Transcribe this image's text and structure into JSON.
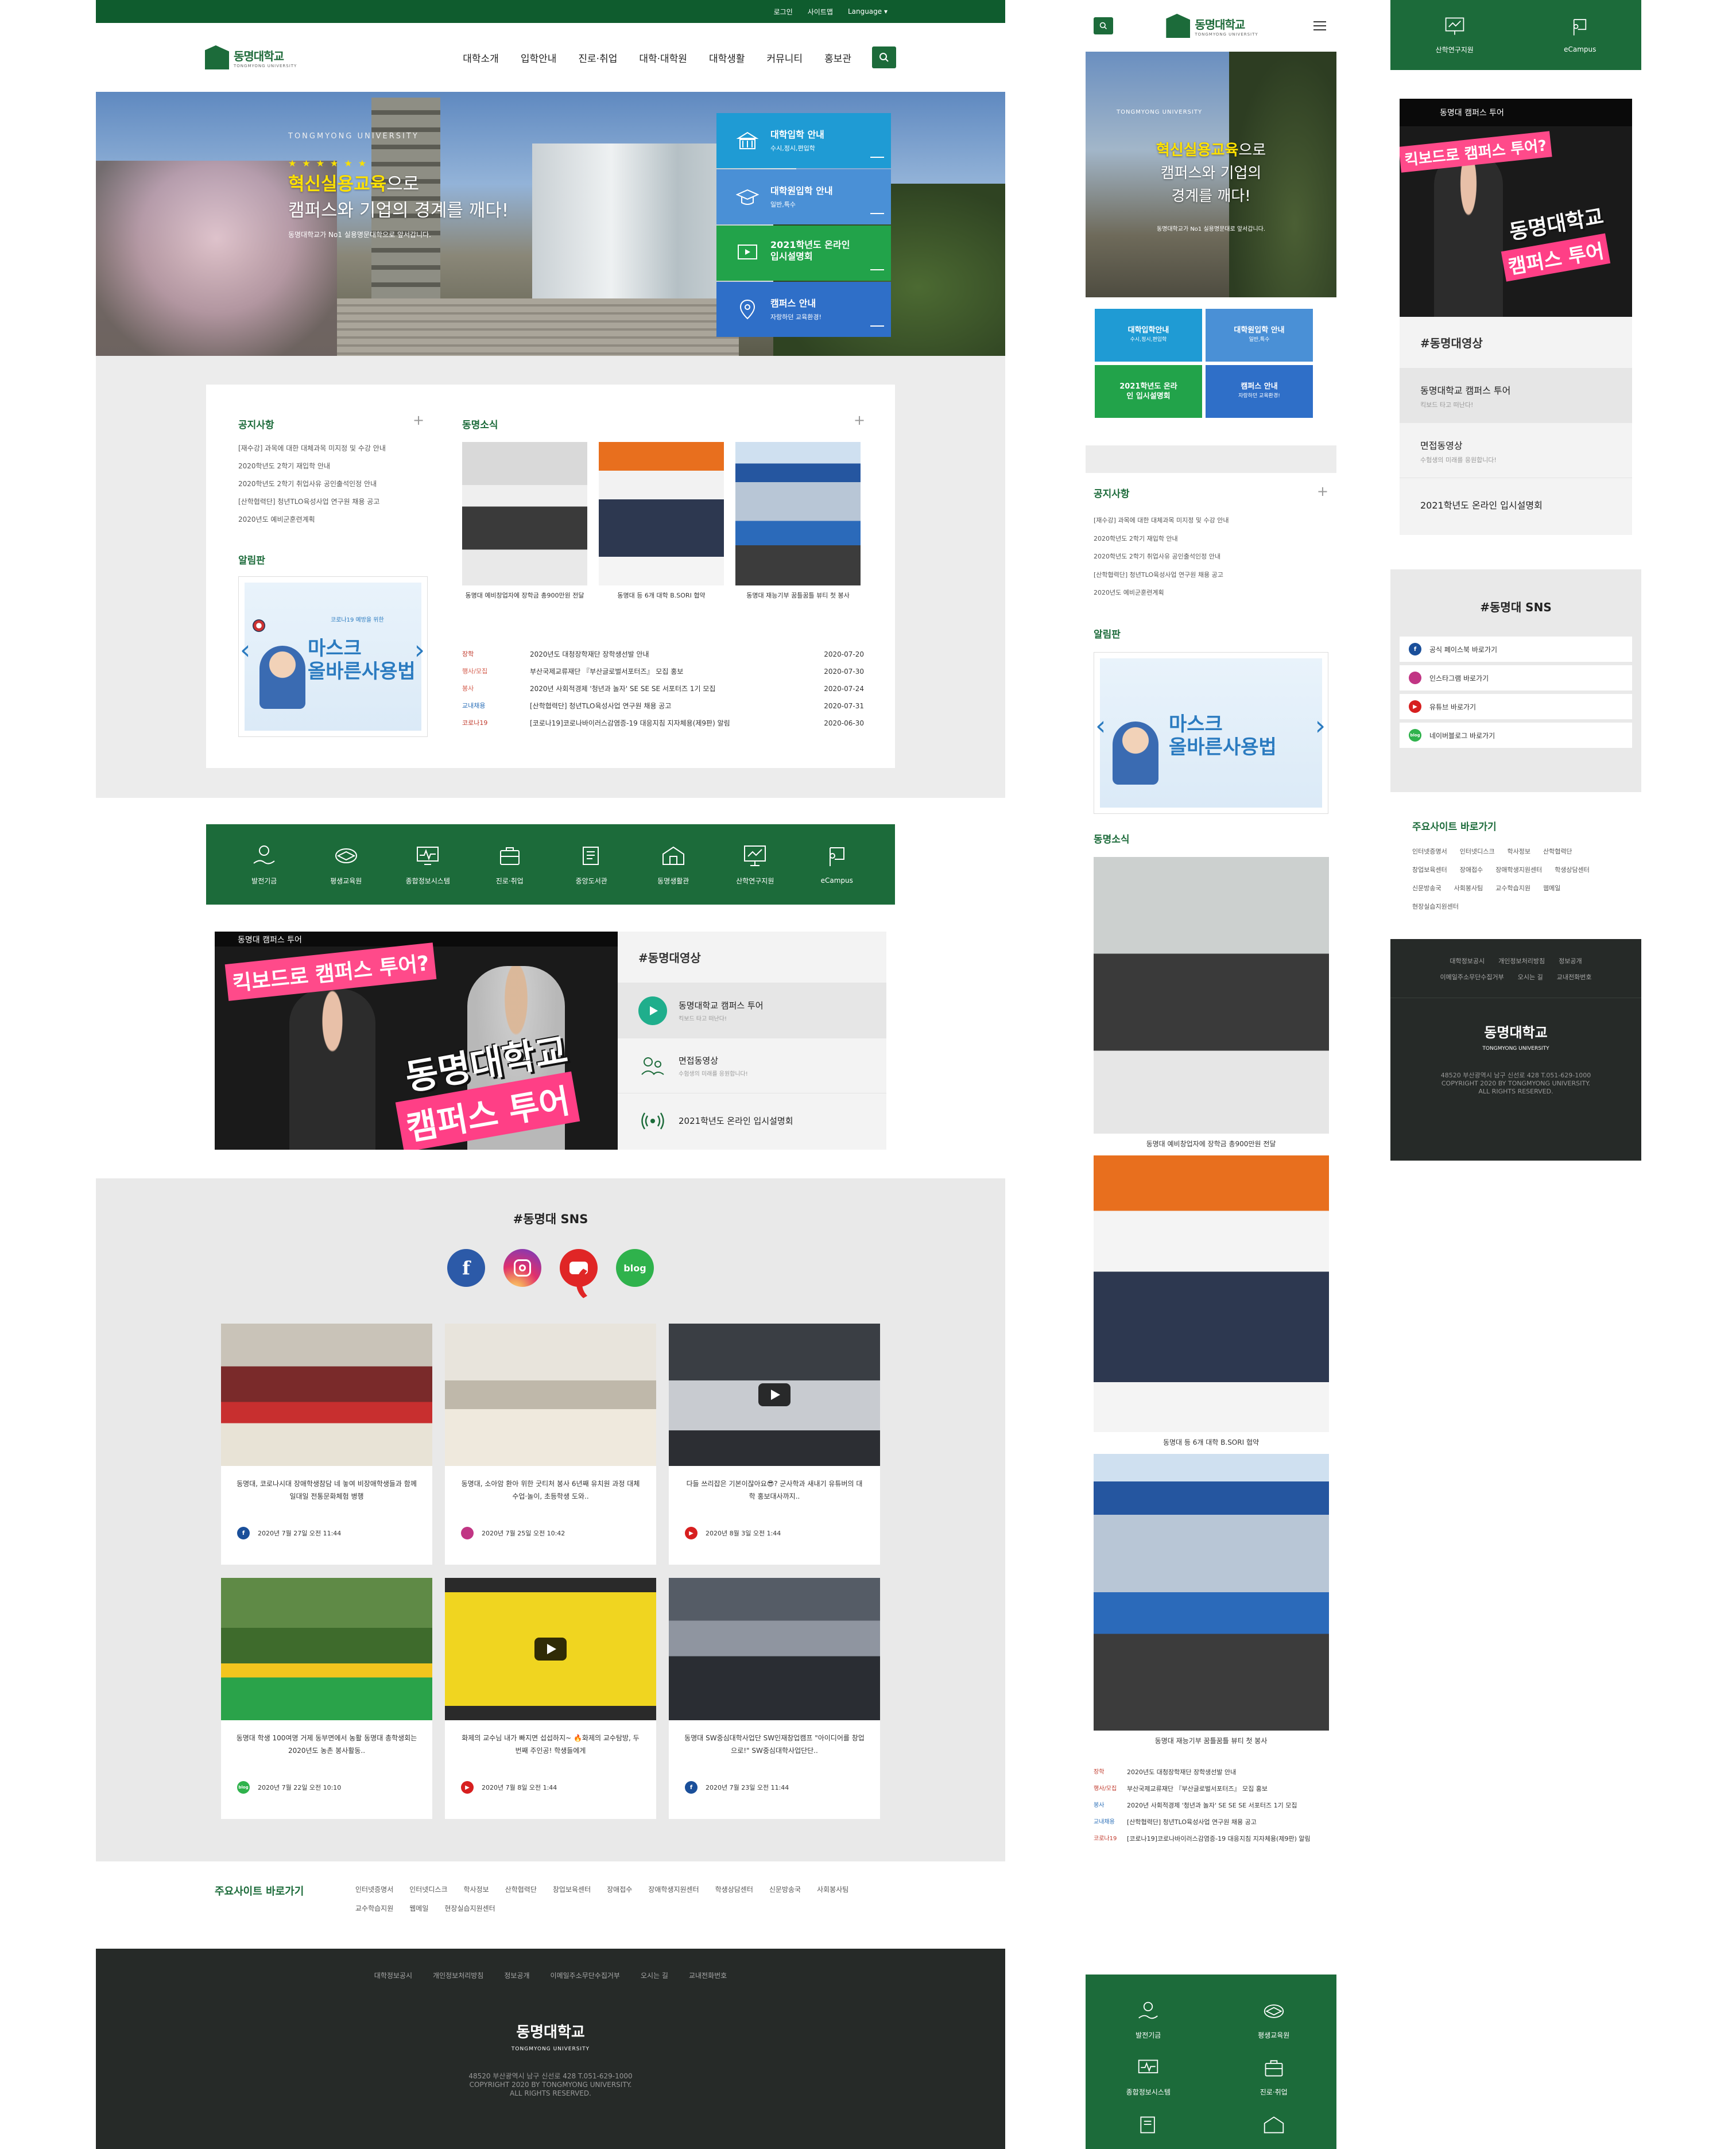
{
  "topbar": {
    "login": "로그인",
    "sitemap": "사이트맵",
    "language": "Language ▾"
  },
  "logo": {
    "name": "동명대학교",
    "eng": "TONGMYONG UNIVERSITY"
  },
  "menu": [
    "대학소개",
    "입학안내",
    "진로·취업",
    "대학·대학원",
    "대학생활",
    "커뮤니티",
    "홍보관"
  ],
  "hero": {
    "uni": "TONGMYONG UNIVERSITY",
    "stars": "★★★★★★",
    "line1_em": "혁신실용교육",
    "line1": "으로",
    "line2": "캠퍼스와 기업의 경계를 깨다!",
    "sub": "동명대학교가 No1 실용명문대학으로 앞서갑니다."
  },
  "quick": [
    {
      "title": "대학입학 안내",
      "sub": "수시,정시,편입학",
      "color": "#1f9bd4"
    },
    {
      "title": "대학원입학 안내",
      "sub": "일반,특수",
      "color": "#4a90d6"
    },
    {
      "title": "2021학년도 온라인 입시설명회",
      "sub": "",
      "color": "#22a34a"
    },
    {
      "title": "캠퍼스 안내",
      "sub": "자랑하던 교육환경!",
      "color": "#2f6fc8"
    }
  ],
  "notice": {
    "title": "공지사항",
    "items": [
      "[재수강] 과목에 대한 대체과목 미지정 및 수강 안내",
      "2020학년도 2학기 재입학 안내",
      "2020학년도 2학기 취업사유 공인출석인정 안내",
      "[산학협력단] 청년TLO육성사업 연구원 채용 공고",
      "2020년도 예비군훈련계획"
    ]
  },
  "alert": {
    "title": "알림판",
    "popup_l1": "마스크",
    "popup_l2": "올바른사용법",
    "popup_top": "코로나19 예방을 위한"
  },
  "news": {
    "title": "동명소식",
    "photos": [
      {
        "cap": "동명대 예비창업자에 장학금 총900만원 전달"
      },
      {
        "cap": "동명대 등 6개 대학 B.SORI 협약"
      },
      {
        "cap": "동명대 재능기부 꿈틀꿈틀 뷰티 첫 봉사"
      }
    ],
    "rows": [
      {
        "cat": "장학",
        "title": "2020년도 대청장학재단 장학생선발 안내",
        "date": "2020-07-20"
      },
      {
        "cat": "행사/모집",
        "title": "부산국제교류재단 『부산글로벌서포터즈』 모집 홍보",
        "date": "2020-07-30"
      },
      {
        "cat": "봉사",
        "title": "2020년 사회적경제 '청년과 놀자' SE SE SE 서포터즈 1기 모집",
        "date": "2020-07-24"
      },
      {
        "cat": "교내채용",
        "title": "[산학협력단] 청년TLO육성사업 연구원 채용 공고",
        "date": "2020-07-31"
      },
      {
        "cat": "코로나19",
        "title": "[코로나19]코로나바이러스감염증-19 대응지침 지자체용(제9판) 알림",
        "date": "2020-06-30"
      }
    ]
  },
  "icons": [
    {
      "label": "발전기금",
      "icon": "fund-icon"
    },
    {
      "label": "평생교육원",
      "icon": "lifelong-icon"
    },
    {
      "label": "종합정보시스템",
      "icon": "info-system-icon"
    },
    {
      "label": "진로·취업",
      "icon": "career-icon"
    },
    {
      "label": "중앙도서관",
      "icon": "library-icon"
    },
    {
      "label": "동명생활관",
      "icon": "dormitory-icon"
    },
    {
      "label": "산학연구지원",
      "icon": "research-icon"
    },
    {
      "label": "eCampus",
      "icon": "ecampus-icon"
    }
  ],
  "video": {
    "bar": "동명대 캠퍼스 투어",
    "t1": "킥보드로 캠퍼스 투어?",
    "t2": "동명대학교",
    "t3": "캠퍼스 투어",
    "head": "#동명대영상",
    "items": [
      {
        "title": "동명대학교 캠퍼스 투어",
        "sub": "킥보드 타고 떠난다!"
      },
      {
        "title": "면접동영상",
        "sub": "수험생의 미래를 응원합니다!"
      },
      {
        "title": "2021학년도 온라인 입시설명회",
        "sub": ""
      }
    ]
  },
  "sns": {
    "head": "#동명대 SNS",
    "icons": [
      "f",
      "",
      "",
      "blog"
    ],
    "cards": [
      {
        "text": "동명대, 코로나시대 장애학생참담 네 놓여 비장애학생들과 함께 일대일 전통문화체험 병행",
        "date": "2020년 7월 27일 오전 11:44",
        "src": "f",
        "color": "#1a4f9a"
      },
      {
        "text": "동명대, 소아암 환아 위한 굿티처 봉사 6년째 유치원 과정 대체 수업·놀이, 초등학생 도와..",
        "date": "2020년 7월 25일 오전 10:42",
        "src": "ig",
        "color": "#c13584"
      },
      {
        "text": "다들 쓰리잡은 기본이잖아요😎? 군사학과 새내기 유튜버의 대학 홍보대사까지..",
        "date": "2020년 8월 3일 오전 1:44",
        "src": "yt",
        "color": "#d71f1f"
      },
      {
        "text": "동명대 학생 100여명 거제 동부면에서 농활 동명대 총학생회는 2020년도 농촌 봉사활동..",
        "date": "2020년 7월 22일 오전 10:10",
        "src": "blog",
        "color": "#2fb24c"
      },
      {
        "text": "화제의 교수님 내가 빠지면 섭섭하지~ 🔥화제의 교수탐방, 두 번째 주인공! 학생들에게",
        "date": "2020년 7월 8일 오전 1:44",
        "src": "yt",
        "color": "#d71f1f"
      },
      {
        "text": "동명대 SW중심대학사업단 SW인재창업캠프 \"아이디어를 창업으로!\" SW중심대학사업단단..",
        "date": "2020년 7월 23일 오전 11:44",
        "src": "f",
        "color": "#1a4f9a"
      }
    ],
    "mobile_links": [
      "공식 페이스북 바로가기",
      "인스타그램 바로가기",
      "유튜브 바로가기",
      "네이버블로그 바로가기"
    ]
  },
  "shortcuts": {
    "head": "주요사이트 바로가기",
    "items": [
      "인터넷증명서",
      "인터넷디스크",
      "학사정보",
      "산학협력단",
      "창업보육센터",
      "장애접수",
      "장애학생지원센터",
      "학생상담센터",
      "신문방송국",
      "사회봉사팀",
      "교수학습지원",
      "웹메일",
      "현장실습지원센터"
    ]
  },
  "footer": {
    "links": [
      "대학정보공시",
      "개인정보처리방침",
      "정보공개",
      "이메일주소무단수집거부",
      "오시는 길",
      "교내전화번호"
    ],
    "addr": "48520 부산광역시 남구 신선로 428 T.051-629-1000",
    "copy1": "COPYRIGHT 2020 BY TONGMYONG UNIVERSITY.",
    "copy2": "ALL RIGHTS RESERVED."
  },
  "mobile": {
    "hero_l1_em": "혁신실용교육",
    "hero_l1": "으로",
    "hero_l2": "캠퍼스와 기업의",
    "hero_l3": "경계를 깨다!",
    "hero_sub": "동명대학교가 No1 실용명문대로 앞서갑니다.",
    "quick": [
      {
        "t": "대학입학안내",
        "s": "수시,정시,편입학",
        "color": "#1f9bd4"
      },
      {
        "t": "대학원입학 안내",
        "s": "일반,특수",
        "color": "#4a90d6"
      },
      {
        "t": "2021학년도 온라인 입시설명회",
        "s": "",
        "color": "#22a34a"
      },
      {
        "t": "캠퍼스 안내",
        "s": "자랑하던 교육환경!",
        "color": "#2f6fc8"
      }
    ],
    "news_rows": [
      {
        "cat": "장학",
        "title": "2020년도 대청장학재단 장학생선발 안내"
      },
      {
        "cat": "행사/모집",
        "title": "부산국제교류재단 『부산글로벌서포터즈』 모집 홍보"
      },
      {
        "cat": "봉사",
        "title": "2020년 사회적경제 '청년과 놀자' SE SE SE 서포터즈 1기 모집"
      },
      {
        "cat": "교내채용",
        "title": "[산학협력단] 청년TLO육성사업 연구원 채용 공고"
      },
      {
        "cat": "코로나19",
        "title": "[코로나19]코로나바이러스감염증-19 대응지침 지자체용(제9판) 알림"
      }
    ],
    "footer_links": [
      "대학정보공시",
      "개인정보처리방침",
      "정보공개",
      "이메일주소무단수집거부",
      "오시는 길",
      "교내전화번호"
    ]
  }
}
